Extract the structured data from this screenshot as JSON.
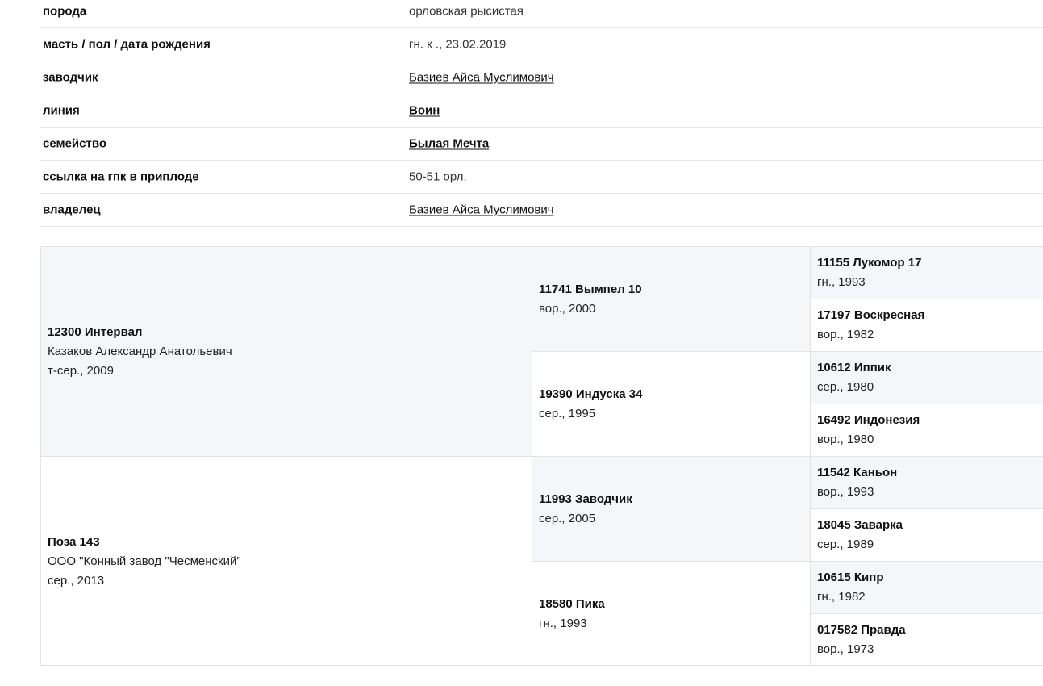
{
  "info": {
    "breed": {
      "label": "порода",
      "value": "орловская рысистая"
    },
    "color_sex_dob": {
      "label": "масть / пол / дата рождения",
      "value": "гн. к ., 23.02.2019"
    },
    "breeder": {
      "label": "заводчик",
      "value": "Базиев Айса Муслимович"
    },
    "line": {
      "label": "линия",
      "value": "Воин"
    },
    "family": {
      "label": "семейство",
      "value": "Былая Мечта"
    },
    "gpk_ref": {
      "label": "ссылка на гпк в приплоде",
      "value": "50-51 орл."
    },
    "owner": {
      "label": "владелец",
      "value": "Базиев Айса Муслимович"
    }
  },
  "pedigree": {
    "sire": {
      "name": "12300 Интервал",
      "owner": "Казаков Александр Анатольевич",
      "details": "т-сер., 2009"
    },
    "dam": {
      "name": "Поза 143",
      "owner": "ООО \"Конный завод \"Чесменский\"",
      "details": "сер., 2013"
    },
    "sire_sire": {
      "name": "11741 Вымпел 10",
      "details": "вор., 2000"
    },
    "sire_dam": {
      "name": "19390 Индуска 34",
      "details": "сер., 1995"
    },
    "dam_sire": {
      "name": "11993 Заводчик",
      "details": "сер., 2005"
    },
    "dam_dam": {
      "name": "18580 Пика",
      "details": "гн., 1993"
    },
    "gen3": [
      {
        "name": "11155 Лукомор 17",
        "details": "гн., 1993"
      },
      {
        "name": "17197 Воскресная",
        "details": "вор., 1982"
      },
      {
        "name": "10612 Иппик",
        "details": "сер., 1980"
      },
      {
        "name": "16492 Индонезия",
        "details": "вор., 1980"
      },
      {
        "name": "11542 Каньон",
        "details": "вор., 1993"
      },
      {
        "name": "18045 Заварка",
        "details": "сер., 1989"
      },
      {
        "name": "10615 Кипр",
        "details": "гн., 1982"
      },
      {
        "name": "017582 Правда",
        "details": "вор., 1973"
      }
    ]
  }
}
